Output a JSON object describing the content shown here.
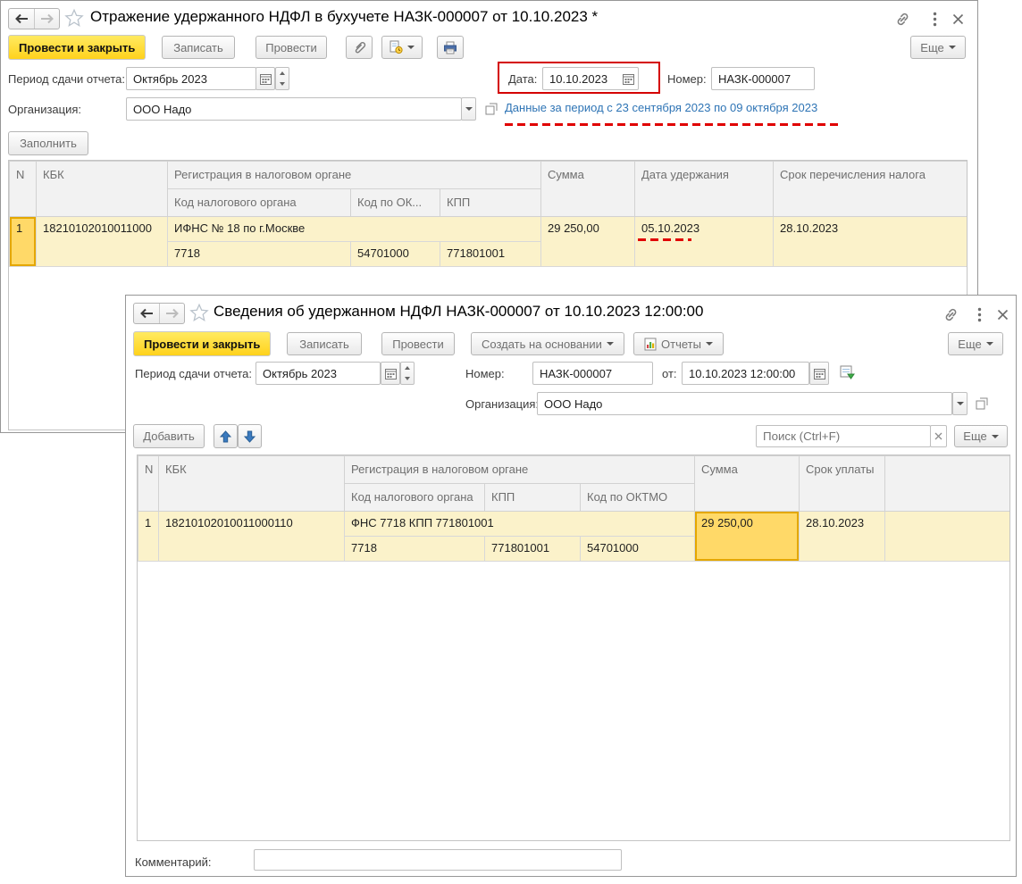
{
  "colors": {
    "annotation_red": "#d40000",
    "primary_button_yellow": "#ffd21c",
    "row_highlight": "#fbf2ca",
    "current_cell": "#ffd968",
    "link_blue": "#2e74b5"
  },
  "window1": {
    "title": "Отражение удержанного НДФЛ в бухучете НАЗК-000007 от 10.10.2023 *",
    "toolbar": {
      "post_and_close": "Провести и закрыть",
      "save": "Записать",
      "post": "Провести",
      "more": "Еще"
    },
    "fields": {
      "period_label": "Период сдачи отчета:",
      "period_value": "Октябрь 2023",
      "date_label": "Дата:",
      "date_value": "10.10.2023",
      "number_label": "Номер:",
      "number_value": "НАЗК-000007",
      "org_label": "Организация:",
      "org_value": "ООО Надо",
      "period_data_link": "Данные за период с 23 сентября 2023 по 09 октября 2023"
    },
    "fill_button": "Заполнить",
    "table": {
      "headers": {
        "n": "N",
        "kbk": "КБК",
        "registration": "Регистрация в налоговом органе",
        "tax_code": "Код налогового органа",
        "ok_code": "Код по ОК...",
        "kpp": "КПП",
        "sum": "Сумма",
        "withhold_date": "Дата удержания",
        "transfer_deadline": "Срок перечисления налога"
      },
      "rows": [
        {
          "n": "1",
          "kbk": "18210102010011000",
          "tax_office": "ИФНС № 18 по г.Москве",
          "tax_code": "7718",
          "ok_code": "54701000",
          "kpp": "771801001",
          "sum": "29 250,00",
          "withhold_date": "05.10.2023",
          "transfer_deadline": "28.10.2023"
        }
      ]
    }
  },
  "window2": {
    "title": "Сведения об удержанном НДФЛ НАЗК-000007 от 10.10.2023 12:00:00",
    "toolbar": {
      "post_and_close": "Провести и закрыть",
      "save": "Записать",
      "post": "Провести",
      "create_based_on": "Создать на основании",
      "reports": "Отчеты",
      "more": "Еще"
    },
    "fields": {
      "period_label": "Период сдачи отчета:",
      "period_value": "Октябрь 2023",
      "number_label": "Номер:",
      "number_value": "НАЗК-000007",
      "from_label": "от:",
      "from_value": "10.10.2023 12:00:00",
      "org_label": "Организация:",
      "org_value": "ООО Надо"
    },
    "commands": {
      "add": "Добавить",
      "search_placeholder": "Поиск (Ctrl+F)",
      "more": "Еще"
    },
    "table": {
      "headers": {
        "n": "N",
        "kbk": "КБК",
        "registration": "Регистрация в налоговом органе",
        "tax_code": "Код налогового органа",
        "kpp": "КПП",
        "oktmo_code": "Код по ОКТМО",
        "sum": "Сумма",
        "pay_deadline": "Срок уплаты"
      },
      "rows": [
        {
          "n": "1",
          "kbk": "18210102010011000110",
          "tax_office": "ФНС 7718 КПП 771801001",
          "tax_code": "7718",
          "kpp": "771801001",
          "oktmo_code": "54701000",
          "sum": "29 250,00",
          "pay_deadline": "28.10.2023"
        }
      ]
    },
    "comment_label": "Комментарий:"
  }
}
